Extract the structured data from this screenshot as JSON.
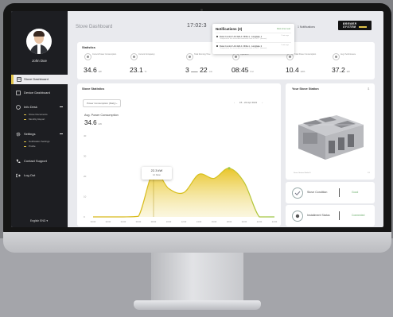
{
  "user": {
    "name": "John Doe"
  },
  "sidebar": {
    "items": [
      {
        "label": "Stove Dashboard"
      },
      {
        "label": "Device Dashboard"
      },
      {
        "label": "Info Desk"
      },
      {
        "label": "Settings"
      },
      {
        "label": "Contact Support"
      },
      {
        "label": "Log Out"
      }
    ],
    "info_sub": [
      "Stove Documents",
      "Monthly Report"
    ],
    "settings_sub": [
      "Notification Settings",
      "Profile"
    ],
    "language": "English ENG"
  },
  "header": {
    "title": "Stove Dashboard",
    "clock": "17:02:3",
    "notifications_button": "1 Notifications",
    "logo_line1": "BREWER",
    "logo_line2": "SYSTEM"
  },
  "notifications": {
    "title": "Notifications (3)",
    "mark_all": "Mark all as read",
    "items": [
      {
        "text": "Data Control Unit ED-1 ODE-1 - Hotplate 1",
        "sub": "Temperature has exceeded maximum limit of 250°C (Sensor)",
        "time": "2 min ago"
      },
      {
        "text": "Data Control Unit ED-1 ODE-1 - Hotplate 2",
        "sub": "Temperature has exceeded maximum limit of 250°C (Sensor)",
        "time": "5 min ago"
      }
    ]
  },
  "statistics": {
    "title": "Statistics",
    "items": [
      {
        "label": "Current Power Consumption",
        "value": "34.6",
        "unit": "kW"
      },
      {
        "label": "Current Occupancy",
        "value": "23.1",
        "unit": "%"
      },
      {
        "label": "Total Running Time",
        "value": "3 ⎼ 22",
        "unit": "min"
      },
      {
        "label": "Operation",
        "value": "08:45",
        "unit": "h/d"
      },
      {
        "label": "Total Power Consumption",
        "value": "10.4",
        "unit": "kWh"
      },
      {
        "label": "Avg. Performance",
        "value": "37.2",
        "unit": "kW"
      }
    ]
  },
  "stove_statistics": {
    "title": "Stove Statistics",
    "select_value": "Power Consumption (Daily)",
    "date": "15 - 22 Apr 2021",
    "avg_label": "Avg. Power Consumption",
    "avg_value": "34.6",
    "avg_unit": "kW",
    "tooltip_value": "22.3 kW",
    "tooltip_time": "12 Noon"
  },
  "stove_station": {
    "title": "Your Stove Station",
    "caption": "Stove Station Model S",
    "page": "1/1"
  },
  "status_cards": [
    {
      "label": "Stove Condition",
      "value": "Good"
    },
    {
      "label": "Installment Status",
      "value": "Connected"
    }
  ],
  "colors": {
    "accent": "#e0c34a",
    "good": "#6bae6b",
    "sidebar": "#1d1e22"
  },
  "chart_data": {
    "type": "area",
    "x": [
      "00:00",
      "02:00",
      "04:00",
      "06:00",
      "08:00",
      "10:00",
      "12:00",
      "14:00",
      "16:00",
      "18:00",
      "20:00",
      "22:00",
      "24:00"
    ],
    "y": [
      0,
      0,
      0,
      0.3,
      22.3,
      14,
      12,
      21,
      19,
      24,
      17,
      0,
      0
    ],
    "ylim": [
      0,
      40
    ],
    "yticks": [
      0,
      10,
      20,
      30,
      40
    ],
    "grid": false
  }
}
